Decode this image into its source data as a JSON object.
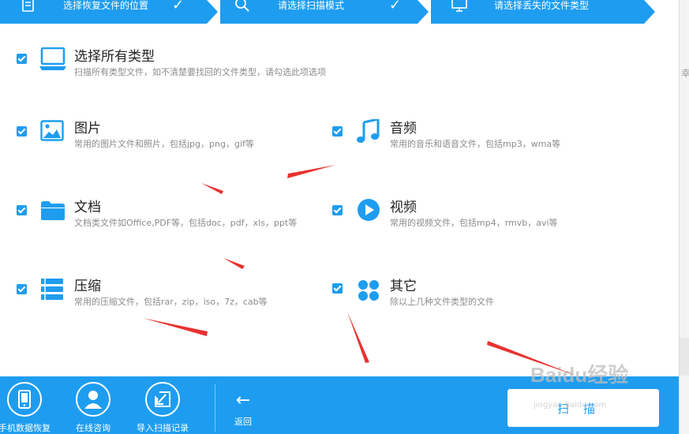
{
  "steps": [
    {
      "label": "选择恢复文件的位置",
      "done": true
    },
    {
      "label": "请选择扫描模式",
      "done": true
    },
    {
      "label": "请选择丢失的文件类型",
      "done": false
    }
  ],
  "options": {
    "all": {
      "title": "选择所有类型",
      "desc": "扫描所有类型文件，如不清楚要找回的文件类型，请勾选此项选项",
      "checked": true
    },
    "pictures": {
      "title": "图片",
      "desc": "常用的图片文件和照片，包括jpg，png，gif等",
      "checked": true
    },
    "audio": {
      "title": "音频",
      "desc": "常用的音乐和语音文件，包括mp3，wma等",
      "checked": true
    },
    "documents": {
      "title": "文档",
      "desc": "文档类文件如Office,PDF等，包括doc，pdf，xls，ppt等",
      "checked": true
    },
    "video": {
      "title": "视频",
      "desc": "常用的视频文件，包括mp4，rmvb，avi等",
      "checked": true
    },
    "archives": {
      "title": "压缩",
      "desc": "常用的压缩文件，包括rar，zip，iso，7z，cab等",
      "checked": true
    },
    "other": {
      "title": "其它",
      "desc": "除以上几种文件类型的文件",
      "checked": true
    }
  },
  "footer": {
    "phone_recovery": "手机数据恢复",
    "online_consult": "在线咨询",
    "import_record": "导入扫描记录",
    "back": "返回",
    "scan": "扫描"
  },
  "watermark": {
    "brand": "Baidu经验",
    "url": "jingyan.baidu.com"
  },
  "right_edge_fragment": "幸",
  "colors": {
    "accent": "#1e9df0",
    "annotation_arrow": "#e8322f"
  }
}
